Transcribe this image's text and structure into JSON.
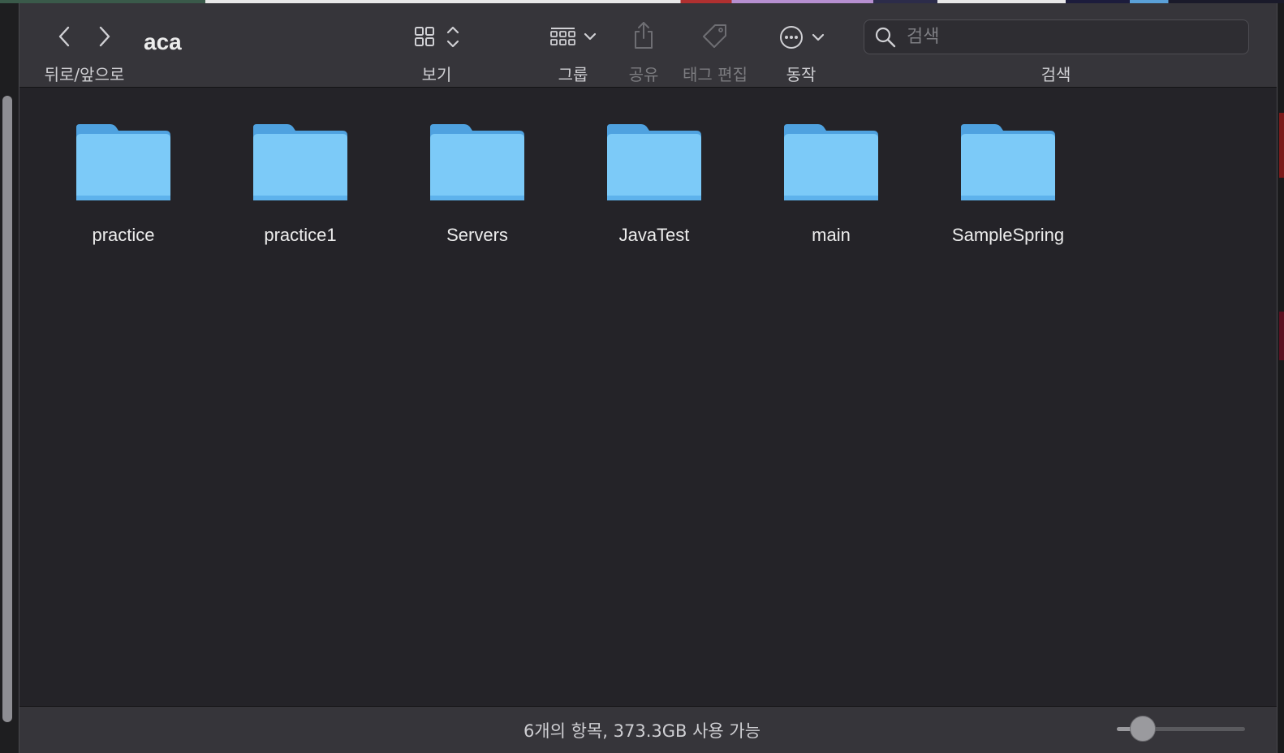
{
  "window": {
    "title": "aca"
  },
  "toolbar": {
    "nav_label": "뒤로/앞으로",
    "view_label": "보기",
    "group_label": "그룹",
    "share_label": "공유",
    "tags_label": "태그 편집",
    "action_label": "동작",
    "search_label": "검색",
    "search_placeholder": "검색"
  },
  "items": [
    {
      "name": "practice",
      "icon": "folder-icon"
    },
    {
      "name": "practice1",
      "icon": "folder-icon"
    },
    {
      "name": "Servers",
      "icon": "folder-icon"
    },
    {
      "name": "JavaTest",
      "icon": "folder-icon"
    },
    {
      "name": "main",
      "icon": "folder-icon"
    },
    {
      "name": "SampleSpring",
      "icon": "folder-icon"
    }
  ],
  "status": {
    "text": "6개의 항목, 373.3GB 사용 가능",
    "icon_size_level": 0.2
  },
  "colors": {
    "folder": "#6ab8f0",
    "folder_tab": "#4fa2e0",
    "window_bg": "#242328",
    "toolbar_bg": "#36353a"
  }
}
